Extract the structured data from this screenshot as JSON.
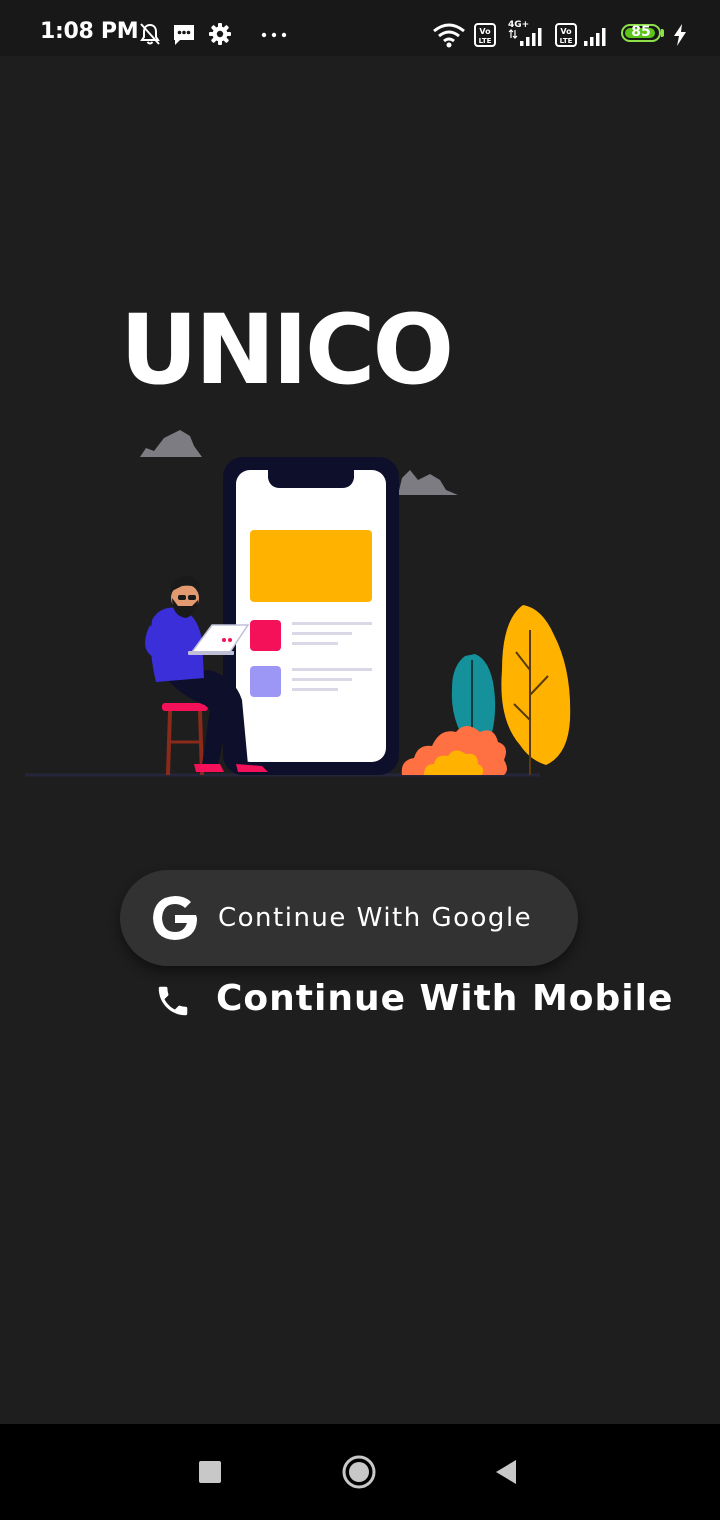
{
  "status_bar": {
    "time": "1:08 PM",
    "battery_level": "85",
    "network_label": "4G+",
    "icons": [
      "muted-bell-icon",
      "message-icon",
      "settings-gear-icon",
      "more-dots-icon",
      "wifi-icon",
      "volte-icon",
      "cellular-signal-icon",
      "battery-icon",
      "charging-bolt-icon"
    ]
  },
  "app": {
    "logo": "UNICO"
  },
  "buttons": {
    "google_label": "Continue With Google",
    "mobile_label": "Continue With Mobile"
  },
  "colors": {
    "background": "#1e1e1e",
    "button_background": "#323232",
    "battery": "#5cc41a",
    "illustration_accent": "#ffb300"
  },
  "nav_bar": {
    "icons": [
      "recents-square-icon",
      "home-circle-icon",
      "back-triangle-icon"
    ]
  }
}
